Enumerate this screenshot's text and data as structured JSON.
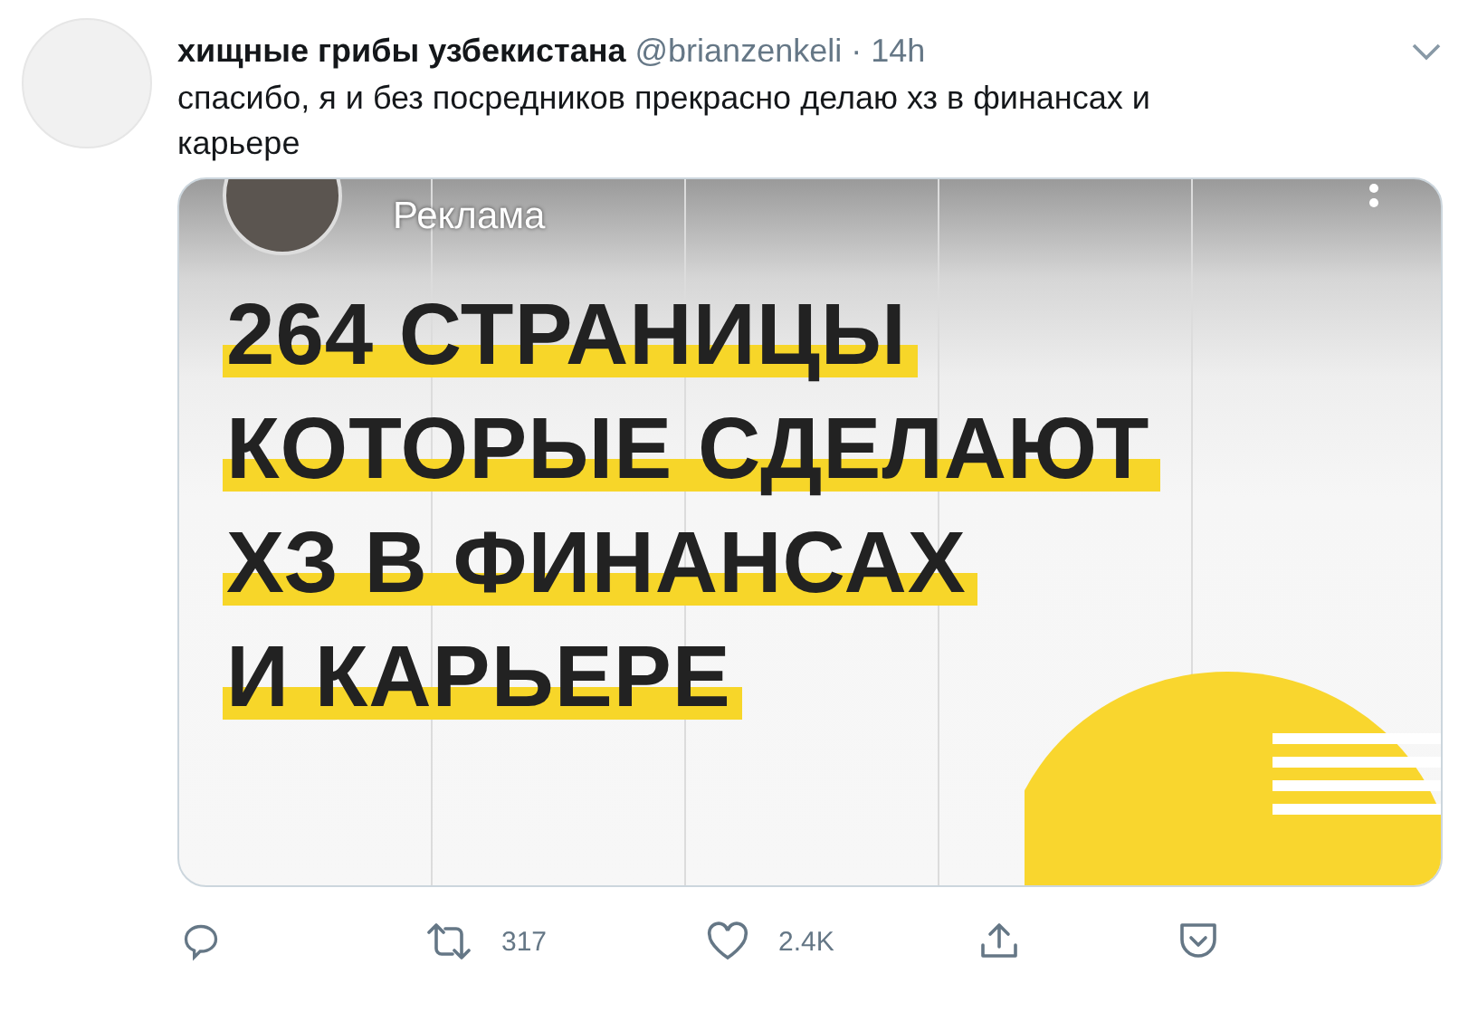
{
  "tweet": {
    "author": "хищные грибы узбекистана",
    "handle": "@brianzenkeli",
    "separator": "·",
    "time": "14h",
    "text": "спасибо, я и без посредников прекрасно делаю хз в финансах и карьере"
  },
  "attachment": {
    "label": "Реклама",
    "headline": [
      "264 СТРАНИЦЫ",
      "КОТОРЫЕ СДЕЛАЮТ",
      "ХЗ В ФИНАНСАХ",
      "И КАРЬЕРЕ"
    ]
  },
  "actions": [
    {
      "kind": "reply"
    },
    {
      "kind": "retweet",
      "count": "317"
    },
    {
      "kind": "like",
      "count": "2.4K"
    },
    {
      "kind": "share"
    },
    {
      "kind": "save"
    }
  ]
}
